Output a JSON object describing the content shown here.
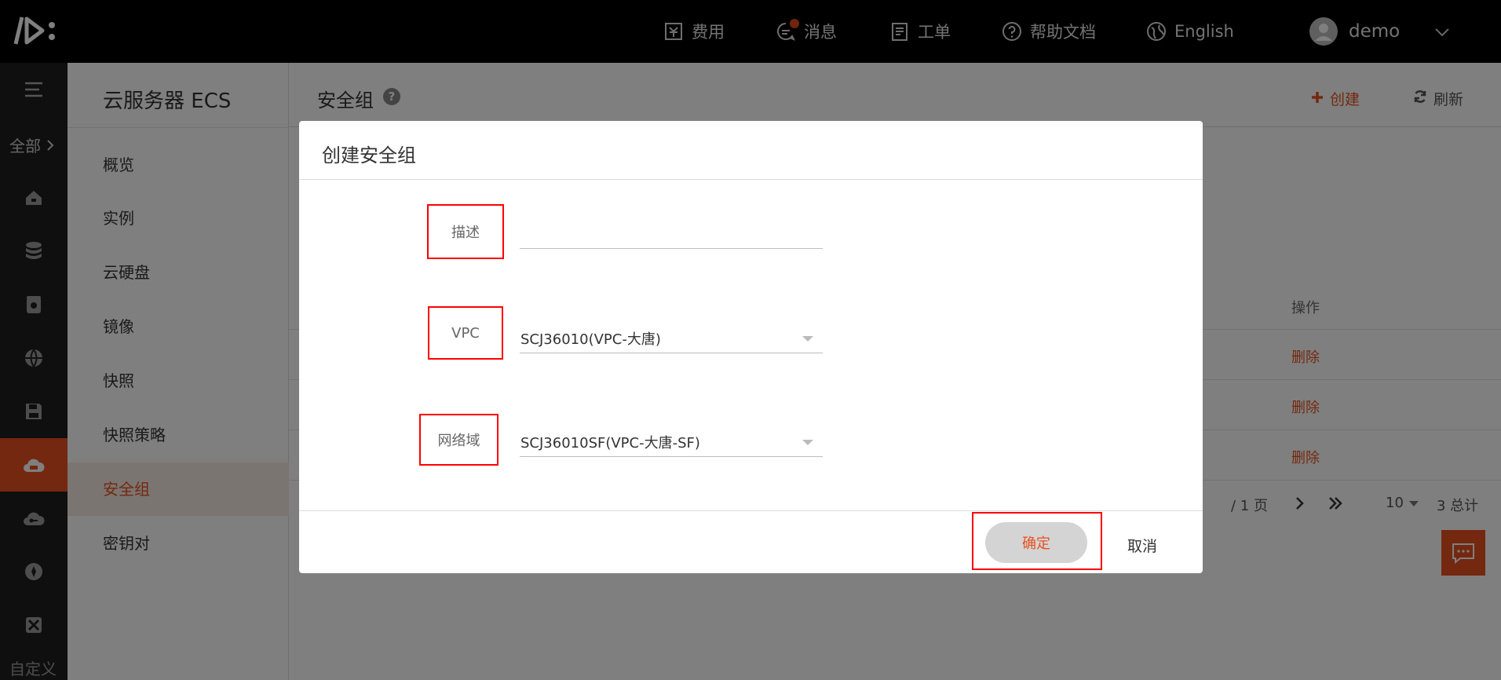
{
  "topbar": {
    "nav": [
      {
        "key": "billing",
        "label": "费用",
        "icon": "billing-icon"
      },
      {
        "key": "messages",
        "label": "消息",
        "icon": "message-icon"
      },
      {
        "key": "tickets",
        "label": "工单",
        "icon": "ticket-icon"
      },
      {
        "key": "help",
        "label": "帮助文档",
        "icon": "help-icon"
      },
      {
        "key": "language",
        "label": "English",
        "icon": "globe-icon"
      }
    ],
    "user": {
      "name": "demo"
    }
  },
  "rail": {
    "all_label": "全部",
    "custom_label": "自定义",
    "active_index": 5
  },
  "sidebar": {
    "title": "云服务器 ECS",
    "items": [
      {
        "label": "概览"
      },
      {
        "label": "实例"
      },
      {
        "label": "云硬盘"
      },
      {
        "label": "镜像"
      },
      {
        "label": "快照"
      },
      {
        "label": "快照策略"
      },
      {
        "label": "安全组",
        "active": true
      },
      {
        "label": "密钥对"
      }
    ]
  },
  "main": {
    "title": "安全组",
    "create_label": "创建",
    "refresh_label": "刷新",
    "table": {
      "op_header": "操作",
      "rows": [
        {
          "action": "删除"
        },
        {
          "action": "删除"
        },
        {
          "action": "删除"
        }
      ]
    },
    "pager": {
      "page_info": "/ 1 页",
      "page_size": "10",
      "total": "3 总计"
    }
  },
  "modal": {
    "title": "创建安全组",
    "fields": {
      "description": {
        "label": "描述",
        "value": ""
      },
      "vpc": {
        "label": "VPC",
        "value": "SCJ36010(VPC-大唐)"
      },
      "network_domain": {
        "label": "网络域",
        "value": "SCJ36010SF(VPC-大唐-SF)"
      }
    },
    "confirm_label": "确定",
    "cancel_label": "取消"
  },
  "colors": {
    "accent": "#e8501e",
    "topbar": "#000000",
    "rail": "#1f1f1f",
    "highlight_box": "#ff0000"
  }
}
